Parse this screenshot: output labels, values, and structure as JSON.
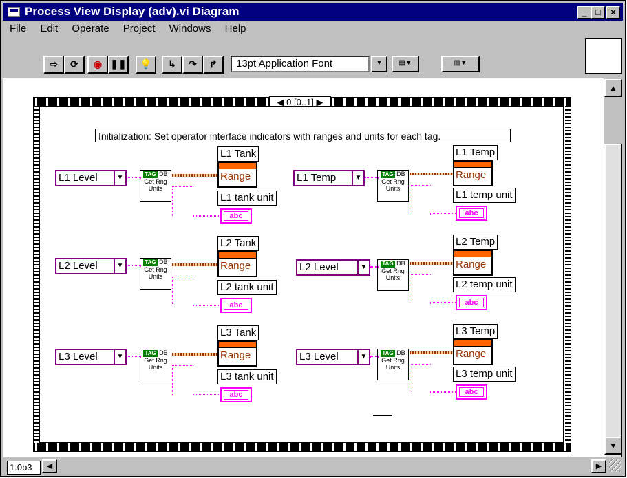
{
  "window": {
    "title": "Process View Display (adv).vi Diagram",
    "buttons": [
      "_",
      "□",
      "×"
    ]
  },
  "menu": [
    "File",
    "Edit",
    "Operate",
    "Project",
    "Windows",
    "Help"
  ],
  "toolbar": {
    "font_select": "13pt Application Font",
    "buttons": [
      "run-icon",
      "run-continuous-icon",
      "abort-icon",
      "pause-icon",
      "highlight-execution-icon",
      "step-into-icon",
      "step-over-icon",
      "step-out-icon"
    ]
  },
  "diagram": {
    "sequence_selector": "0 [0..1]",
    "comment": "Initialization:  Set operator interface indicators with ranges and units for each tag.",
    "subvi": {
      "tag": "TAG",
      "line1": "DB",
      "line2": "Get Rng",
      "line3": "Units"
    },
    "range_label": "Range",
    "abc_label": "abc",
    "left_column": [
      {
        "control": "L1 Level",
        "indicator": "L1 Tank",
        "unit": "L1 tank unit"
      },
      {
        "control": "L2 Level",
        "indicator": "L2 Tank",
        "unit": "L2 tank unit"
      },
      {
        "control": "L3 Level",
        "indicator": "L3 Tank",
        "unit": "L3 tank unit"
      }
    ],
    "right_column": [
      {
        "control": "L1 Temp",
        "indicator": "L1 Temp",
        "unit": "L1 temp unit"
      },
      {
        "control": "L2 Level",
        "indicator": "L2 Temp",
        "unit": "L2 temp unit"
      },
      {
        "control": "L3 Level",
        "indicator": "L3 Temp",
        "unit": "L3 temp unit"
      }
    ]
  },
  "status": {
    "version": "1.0b3"
  }
}
